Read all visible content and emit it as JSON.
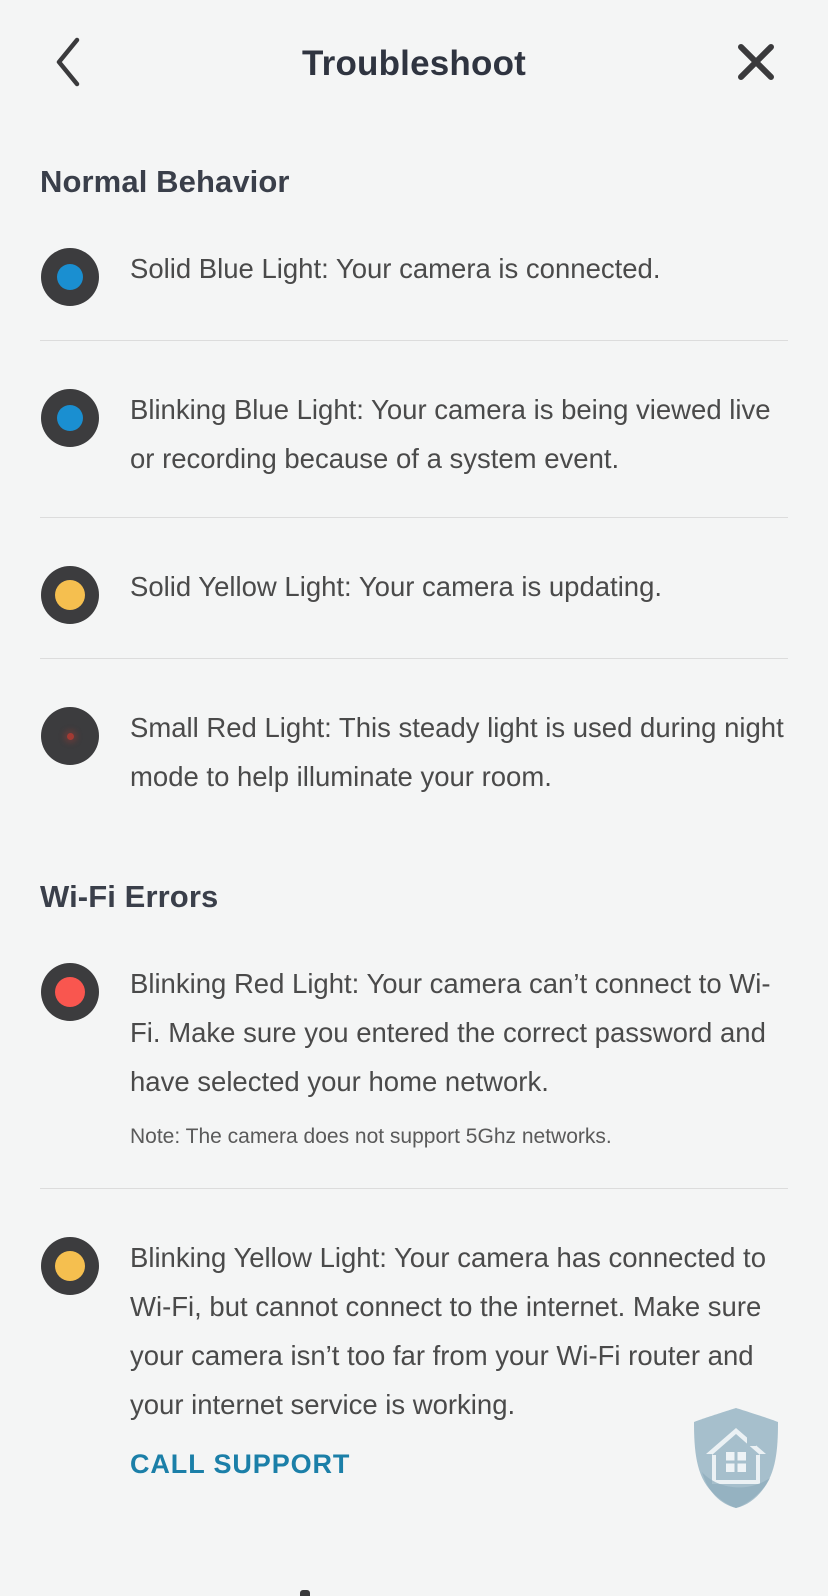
{
  "header": {
    "title": "Troubleshoot",
    "back_icon": "chevron-left-icon",
    "close_icon": "close-icon"
  },
  "sections": [
    {
      "id": "normal-behavior",
      "heading": "Normal Behavior",
      "items": [
        {
          "led": "solid-blue",
          "led_color": "#1a8fd1",
          "text": "Solid Blue Light: Your camera is connected."
        },
        {
          "led": "blinking-blue",
          "led_color": "#1a8fd1",
          "text": "Blinking Blue Light: Your camera is being viewed live or recording because of a system event."
        },
        {
          "led": "solid-yellow",
          "led_color": "#f5bf4f",
          "text": "Solid Yellow Light: Your camera is updating."
        },
        {
          "led": "small-red",
          "led_color": "#a33a33",
          "text": "Small Red Light: This steady light is used during night mode to help illuminate your room."
        }
      ]
    },
    {
      "id": "wifi-errors",
      "heading": "Wi-Fi Errors",
      "items": [
        {
          "led": "blinking-red",
          "led_color": "#f9564f",
          "text": "Blinking Red Light:  Your camera can’t connect to Wi-Fi. Make sure you entered the correct password and have selected your home network.",
          "note": "Note: The camera does not support 5Ghz networks."
        },
        {
          "led": "blinking-yellow",
          "led_color": "#f5bf4f",
          "text": "Blinking Yellow Light:  Your camera has connected to Wi-Fi, but cannot connect to the internet. Make sure your camera isn’t too far from your Wi-Fi router and your internet service is working.",
          "action_label": "CALL SUPPORT"
        }
      ]
    }
  ],
  "watermark": {
    "icon": "house-shield-watermark-icon",
    "color": "#a6bfcc"
  },
  "colors": {
    "background": "#f4f5f5",
    "heading_text": "#3a3f4a",
    "body_text": "#4a4a4a",
    "link": "#1b7fa8",
    "led_housing": "#3c3c3e",
    "divider": "#dcdcdc"
  }
}
